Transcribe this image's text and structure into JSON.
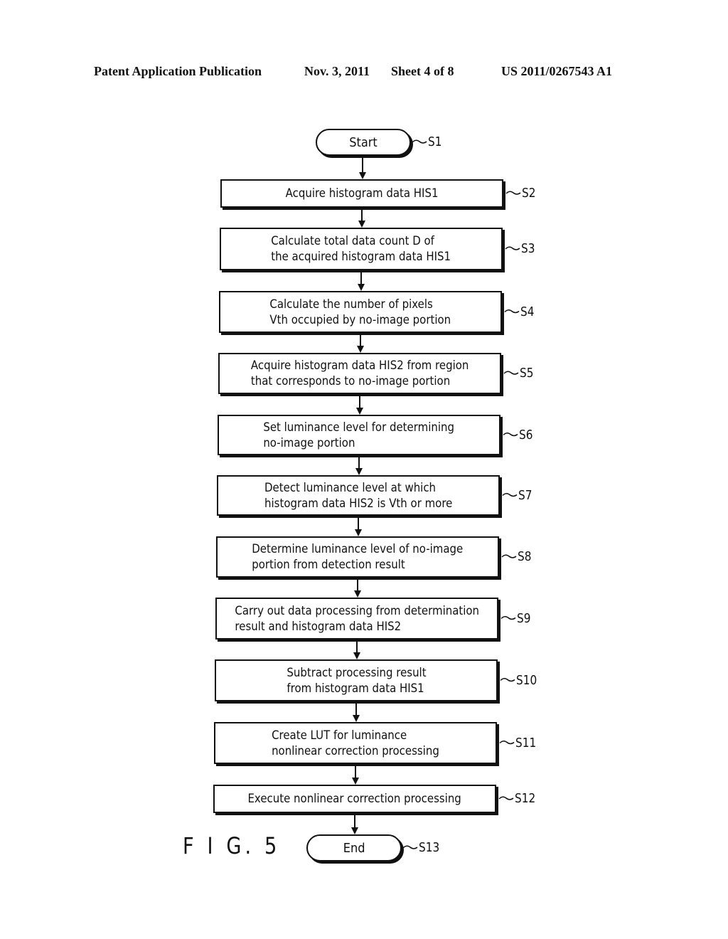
{
  "header": {
    "publication": "Patent Application Publication",
    "date": "Nov. 3, 2011",
    "sheet": "Sheet 4 of 8",
    "number": "US 2011/0267543 A1"
  },
  "figure_label": "F I G. 5",
  "flowchart": {
    "start": {
      "id": "S1",
      "text": "Start"
    },
    "steps": [
      {
        "id": "S2",
        "text": "Acquire histogram data HIS1"
      },
      {
        "id": "S3",
        "text": "Calculate total data count D of\nthe acquired histogram data HIS1"
      },
      {
        "id": "S4",
        "text": "Calculate the number of pixels\nVth occupied by no-image portion"
      },
      {
        "id": "S5",
        "text": "Acquire histogram data HIS2 from region\nthat corresponds to no-image portion"
      },
      {
        "id": "S6",
        "text": "Set luminance level for determining\nno-image portion"
      },
      {
        "id": "S7",
        "text": "Detect luminance level at which\nhistogram data HIS2 is Vth or more"
      },
      {
        "id": "S8",
        "text": "Determine luminance level of no-image\nportion from detection result"
      },
      {
        "id": "S9",
        "text": "Carry out data processing from determination\nresult and histogram data HIS2"
      },
      {
        "id": "S10",
        "text": "Subtract processing result\nfrom histogram data HIS1"
      },
      {
        "id": "S11",
        "text": "Create LUT for luminance\nnonlinear correction processing"
      },
      {
        "id": "S12",
        "text": "Execute nonlinear correction processing"
      }
    ],
    "end": {
      "id": "S13",
      "text": "End"
    }
  }
}
